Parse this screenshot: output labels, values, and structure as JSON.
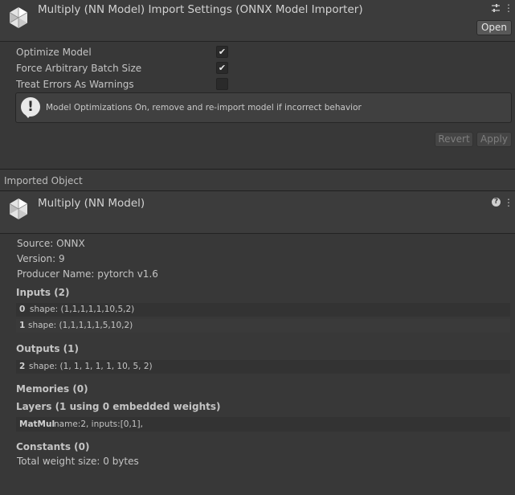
{
  "header": {
    "title": "Multiply (NN Model) Import Settings (ONNX Model Importer)",
    "open_label": "Open"
  },
  "settings": [
    {
      "label": "Optimize Model",
      "checked": true
    },
    {
      "label": "Force Arbitrary Batch Size",
      "checked": true
    },
    {
      "label": "Treat Errors As Warnings",
      "checked": false
    }
  ],
  "help": {
    "icon": "!",
    "text": "Model Optimizations On, remove and re-import model if incorrect behavior"
  },
  "actions": {
    "revert_label": "Revert",
    "apply_label": "Apply"
  },
  "imported_object": {
    "section_label": "Imported Object",
    "title": "Multiply (NN Model)",
    "help_icon": "?",
    "menu_icon": "⋮"
  },
  "model_info": {
    "source": "Source: ONNX",
    "version": "Version: 9",
    "producer": "Producer Name: pytorch v1.6"
  },
  "inputs": {
    "heading": "Inputs (2)",
    "rows": [
      {
        "index": "0",
        "value": "shape: (1,1,1,1,1,10,5,2)"
      },
      {
        "index": "1",
        "value": "shape: (1,1,1,1,1,5,10,2)"
      }
    ]
  },
  "outputs": {
    "heading": "Outputs (1)",
    "rows": [
      {
        "index": "2",
        "value": "shape: (1, 1, 1, 1, 1, 10, 5, 2)"
      }
    ]
  },
  "memories": {
    "heading": "Memories (0)"
  },
  "layers": {
    "heading": "Layers (1 using 0 embedded weights)",
    "rows": [
      {
        "index": "MatMul",
        "value": "name:2, inputs:[0,1],"
      }
    ]
  },
  "constants": {
    "heading": "Constants (0)",
    "total": "Total weight size: 0 bytes"
  },
  "icons": {
    "settings": "sliders-icon",
    "menu": "kebab-menu-icon"
  }
}
